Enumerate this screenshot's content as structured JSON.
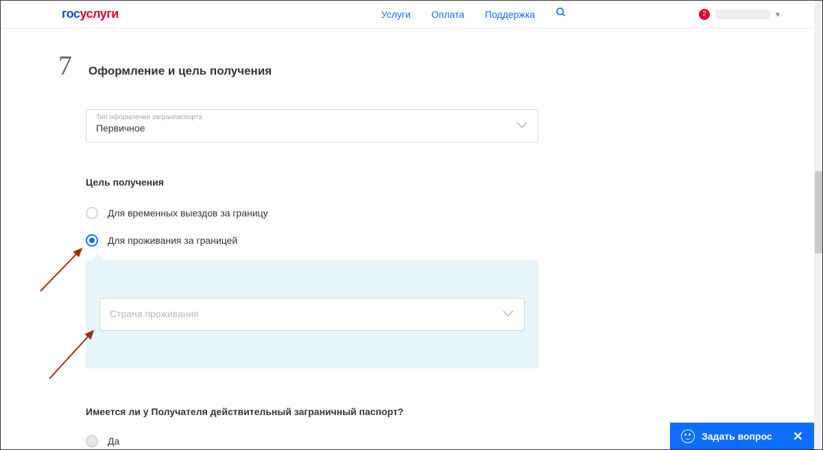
{
  "header": {
    "logo_parts": [
      "гос",
      "услуги"
    ],
    "nav": {
      "services": "Услуги",
      "payment": "Оплата",
      "support": "Поддержка"
    },
    "notifications_count": "2"
  },
  "step": {
    "number": "7",
    "title": "Оформление и цель получения"
  },
  "form": {
    "passport_type_label": "Тип оформления загранпаспорта",
    "passport_type_value": "Первичное",
    "purpose_label": "Цель получения",
    "purpose_options": {
      "temp": "Для временных выездов за границу",
      "residence": "Для проживания за границей"
    },
    "country_placeholder": "Страна проживания",
    "has_passport_label": "Имеется ли у Получателя действительный заграничный паспорт?",
    "has_passport_yes": "Да"
  },
  "ask": {
    "label": "Задать вопрос"
  }
}
